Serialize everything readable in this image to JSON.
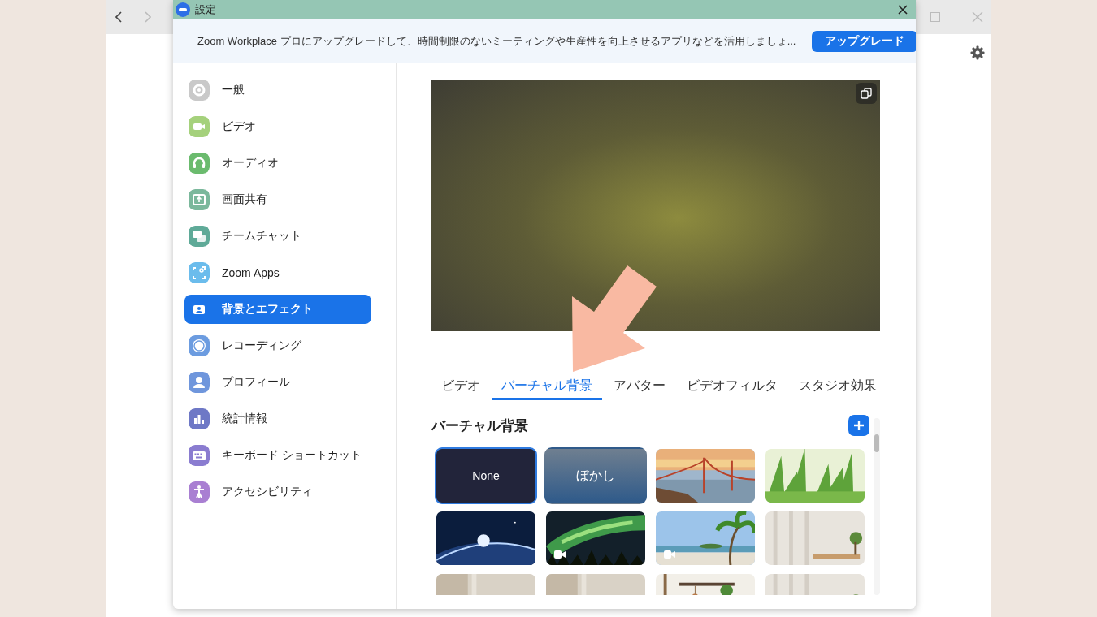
{
  "window": {
    "title": "設定"
  },
  "banner": {
    "text": "Zoom Workplace プロにアップグレードして、時間制限のないミーティングや生産性を向上させるアプリなどを活用しましょ...",
    "button": "アップグレード"
  },
  "sidebar": {
    "items": [
      {
        "label": "一般",
        "color": "#c9c9c9",
        "selected": false
      },
      {
        "label": "ビデオ",
        "color": "#a5d17c",
        "selected": false
      },
      {
        "label": "オーディオ",
        "color": "#6bbb6e",
        "selected": false
      },
      {
        "label": "画面共有",
        "color": "#7bb89c",
        "selected": false
      },
      {
        "label": "チームチャット",
        "color": "#5faa98",
        "selected": false
      },
      {
        "label": "Zoom Apps",
        "color": "#6bbcec",
        "selected": false
      },
      {
        "label": "背景とエフェクト",
        "color": "#ffffff",
        "selected": true
      },
      {
        "label": "レコーディング",
        "color": "#6c9ce0",
        "selected": false
      },
      {
        "label": "プロフィール",
        "color": "#6f96dc",
        "selected": false
      },
      {
        "label": "統計情報",
        "color": "#6e78c6",
        "selected": false
      },
      {
        "label": "キーボード ショートカット",
        "color": "#8a7cd0",
        "selected": false
      },
      {
        "label": "アクセシビリティ",
        "color": "#a97fd2",
        "selected": false
      }
    ]
  },
  "tabs": [
    {
      "label": "ビデオ",
      "selected": false
    },
    {
      "label": "バーチャル背景",
      "selected": true
    },
    {
      "label": "アバター",
      "selected": false
    },
    {
      "label": "ビデオフィルタ",
      "selected": false
    },
    {
      "label": "スタジオ効果",
      "selected": false
    }
  ],
  "section": {
    "title": "バーチャル背景"
  },
  "backgrounds": [
    {
      "kind": "none",
      "label": "None",
      "selected": true,
      "video": false
    },
    {
      "kind": "blur",
      "label": "ぼかし",
      "selected": false,
      "video": false
    },
    {
      "kind": "picture",
      "selected": false,
      "video": false
    },
    {
      "kind": "picture",
      "selected": false,
      "video": false
    },
    {
      "kind": "picture",
      "selected": false,
      "video": false
    },
    {
      "kind": "picture",
      "selected": false,
      "video": true
    },
    {
      "kind": "picture",
      "selected": false,
      "video": true
    },
    {
      "kind": "picture",
      "selected": false,
      "video": false
    },
    {
      "kind": "picture",
      "selected": false
    },
    {
      "kind": "picture",
      "selected": false
    },
    {
      "kind": "picture",
      "selected": false
    },
    {
      "kind": "picture",
      "selected": false
    }
  ]
}
